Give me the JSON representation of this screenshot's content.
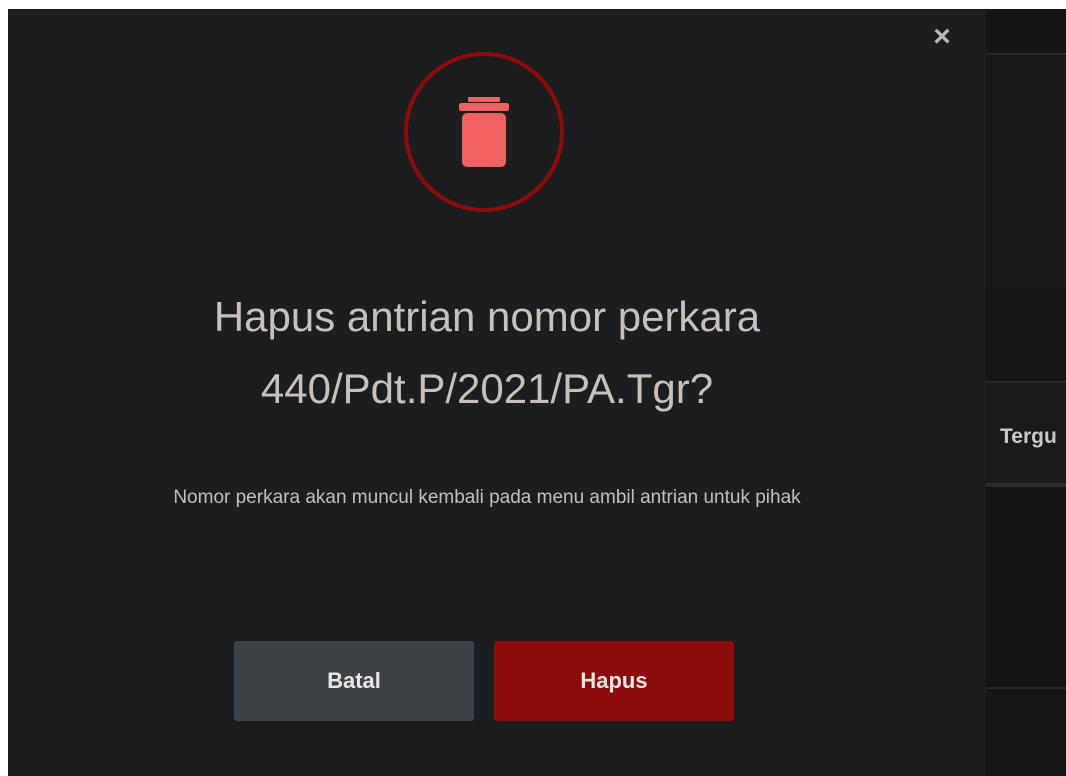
{
  "modal": {
    "close_label": "×",
    "icon": "trash-icon",
    "title_line1": "Hapus antrian nomor perkara",
    "title_line2": "440/Pdt.P/2021/PA.Tgr?",
    "subtitle": "Nomor perkara akan muncul kembali pada menu ambil antrian untuk pihak",
    "cancel_label": "Batal",
    "delete_label": "Hapus"
  },
  "background": {
    "column_header_partial": "Tergu"
  },
  "colors": {
    "modal_bg": "#1c1d1e",
    "accent_red": "#8c0c0c",
    "icon_red": "#f06262",
    "cancel_gray": "#3d4246"
  }
}
